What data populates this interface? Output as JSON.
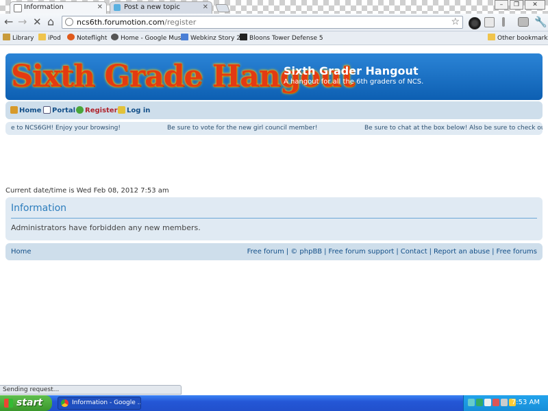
{
  "browser": {
    "tabs": [
      {
        "title": "Information",
        "active": true
      },
      {
        "title": "Post a new topic",
        "active": false
      }
    ],
    "url_host": "ncs6th.forumotion.com",
    "url_path": "/register",
    "bookmarks": [
      "Library",
      "iPod",
      "Noteflight",
      "Home - Google Music",
      "Webkinz Story 2",
      "Bloons Tower Defense 5"
    ],
    "other_bookmarks": "Other bookmarks",
    "status": "Sending request..."
  },
  "site": {
    "logo_text": "Sixth Grade Hangout",
    "title": "Sixth Grader Hangout",
    "description": "A hangout for all the 6th graders of NCS.",
    "nav": {
      "home": "Home",
      "portal": "Portal",
      "register": "Register",
      "login": "Log in"
    },
    "marquee": [
      "e to NCS6GH! Enjoy your browsing!",
      "Be sure to vote for the new girl council member!",
      "Be sure to chat at the box below! Also be sure to check ou"
    ],
    "datetime": "Current date/time is Wed Feb 08, 2012 7:53 am",
    "panel_title": "Information",
    "panel_message": "Administrators have forbidden any new members.",
    "footer_home": "Home",
    "footer_links": [
      "Free forum",
      "© phpBB",
      "Free forum support",
      "Contact",
      "Report an abuse",
      "Free forums"
    ]
  },
  "taskbar": {
    "start": "start",
    "task_item": "Information - Google ...",
    "clock": "7:53 AM"
  },
  "colors": {
    "banner": "#1a6fc4",
    "nav_bg": "#cedeeb",
    "panel_bg": "#e0eaf3",
    "link": "#134f88",
    "register": "#b0242c",
    "taskbar": "#2457d6",
    "start_green": "#3a962b"
  }
}
